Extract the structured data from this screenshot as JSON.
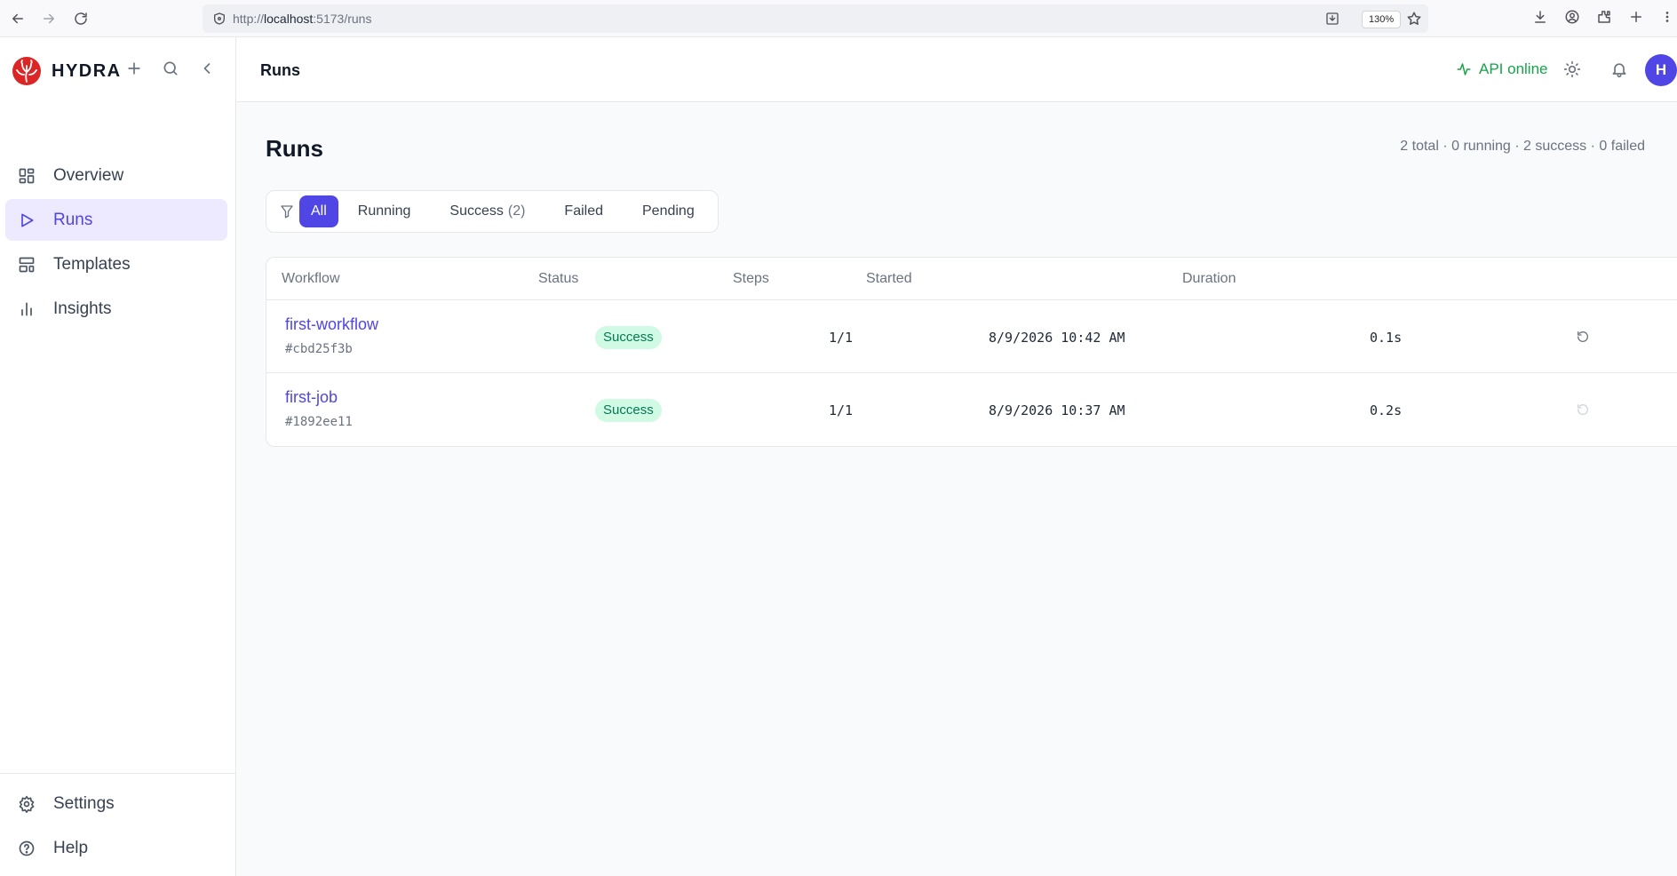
{
  "browser": {
    "url_prefix": "http://",
    "url_host": "localhost",
    "url_rest": ":5173/runs",
    "zoom": "130%"
  },
  "sidebar": {
    "brand": "HYDRA",
    "nav": [
      {
        "label": "Overview",
        "icon": "layout-grid-icon",
        "active": false
      },
      {
        "label": "Runs",
        "icon": "play-icon",
        "active": true
      },
      {
        "label": "Templates",
        "icon": "template-icon",
        "active": false
      },
      {
        "label": "Insights",
        "icon": "bar-chart-icon",
        "active": false
      }
    ],
    "footer": [
      {
        "label": "Settings",
        "icon": "gear-icon"
      },
      {
        "label": "Help",
        "icon": "help-circle-icon"
      }
    ]
  },
  "header": {
    "title": "Runs",
    "api_status": "API online",
    "avatar_initial": "H"
  },
  "page": {
    "title": "Runs",
    "summary": "2 total · 0 running · 2 success · 0 failed"
  },
  "filters": {
    "all": "All",
    "running": "Running",
    "success": "Success",
    "success_count": "(2)",
    "failed": "Failed",
    "pending": "Pending",
    "active": "All"
  },
  "table": {
    "columns": [
      "Workflow",
      "Status",
      "Steps",
      "Started",
      "Duration"
    ],
    "rows": [
      {
        "name": "first-workflow",
        "id": "#cbd25f3b",
        "status": "Success",
        "steps": "1/1",
        "started": "8/9/2026 10:42 AM",
        "duration": "0.1s"
      },
      {
        "name": "first-job",
        "id": "#1892ee11",
        "status": "Success",
        "steps": "1/1",
        "started": "8/9/2026 10:37 AM",
        "duration": "0.2s"
      }
    ]
  },
  "colors": {
    "accent": "#4f46e5",
    "success_bg": "#d1fae5",
    "success_text": "#047857",
    "online": "#16a34a"
  }
}
